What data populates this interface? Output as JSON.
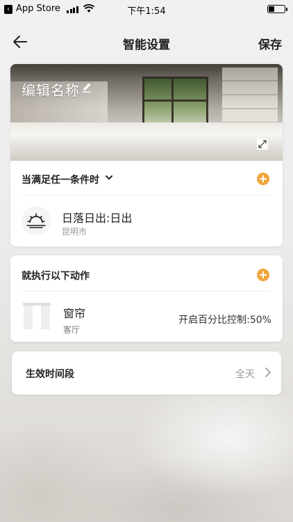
{
  "status_bar": {
    "back_app": "App Store",
    "time": "下午1:54"
  },
  "nav": {
    "title": "智能设置",
    "save_label": "保存"
  },
  "hero": {
    "title": "编辑名称"
  },
  "conditions": {
    "header": "当满足任一条件时",
    "items": [
      {
        "title": "日落日出:日出",
        "subtitle": "昆明市",
        "icon": "sunrise-icon"
      }
    ]
  },
  "actions": {
    "header": "就执行以下动作",
    "items": [
      {
        "title": "窗帘",
        "subtitle": "客厅",
        "value": "开启百分比控制:50%",
        "icon": "curtain-icon"
      }
    ]
  },
  "effective_time": {
    "label": "生效时间段",
    "value": "全天"
  },
  "colors": {
    "accent": "#f0a63a"
  }
}
